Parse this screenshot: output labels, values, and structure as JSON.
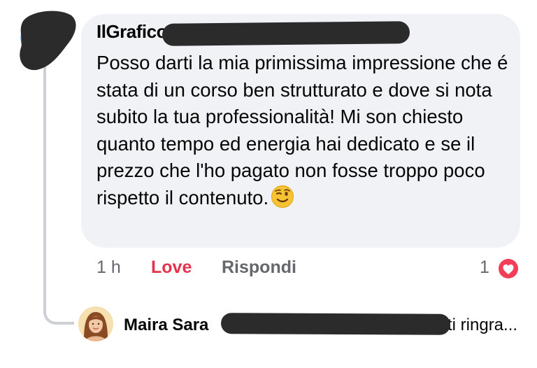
{
  "comment": {
    "author_visible": "IlGrafico",
    "text": "Posso darti la mia primissima impressione che é stata di un corso ben strutturato e dove si nota subito la tua professionalità! Mi son chiesto quanto tempo ed energia hai dedicato e se il prezzo che l'ho pagato non fosse troppo poco rispetto il contenuto.",
    "emoji": "winking-face",
    "time": "1 h",
    "love_label": "Love",
    "reply_label": "Rispondi",
    "reaction_count": "1",
    "reaction_type": "heart"
  },
  "reply_preview": {
    "author_visible": "Maira Sara",
    "text_visible": "ti ringra..."
  },
  "colors": {
    "bubble": "#f0f2f5",
    "love": "#e4344d",
    "muted": "#65676b",
    "thread_line": "#ccd0d5",
    "redaction": "#2b2b2b"
  }
}
